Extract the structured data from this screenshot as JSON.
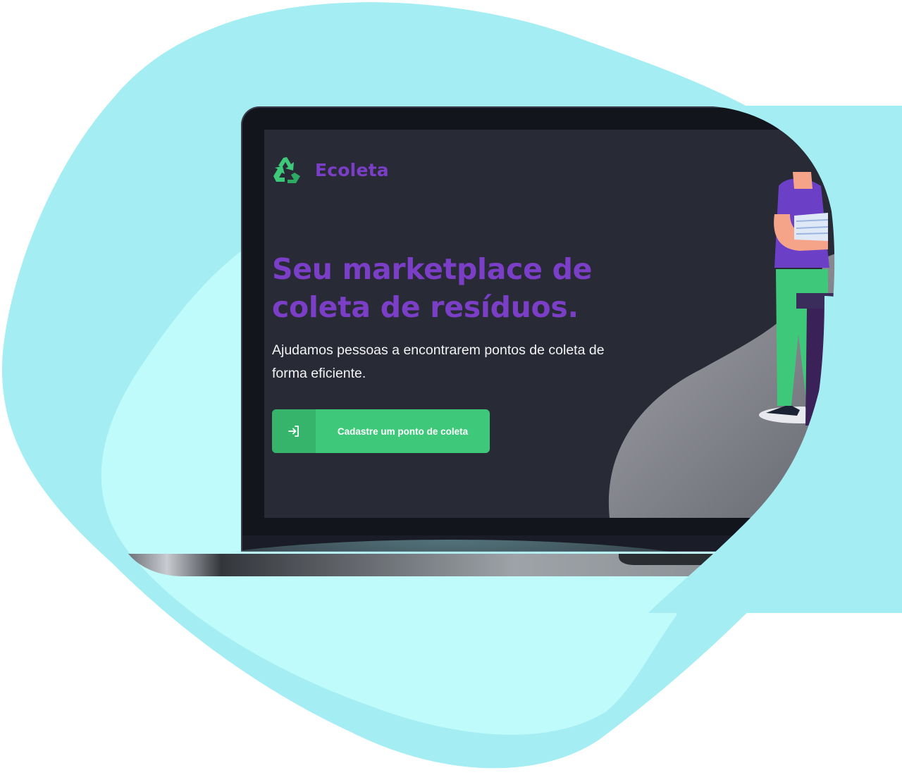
{
  "app": {
    "brand_name": "Ecoleta",
    "logo_icon": "recycle-icon"
  },
  "hero": {
    "title": "Seu marketplace de coleta de resíduos.",
    "description": "Ajudamos pessoas a encontrarem pontos de coleta de forma eficiente."
  },
  "cta": {
    "label": "Cadastre um ponto de coleta",
    "icon": "sign-in-icon"
  },
  "colors": {
    "brand_purple": "#7b3ec7",
    "brand_green": "#3ec97a",
    "screen_background": "#282a36",
    "blob_cyan": "#a3edf3",
    "blob_light_cyan": "#c0fbfb"
  }
}
